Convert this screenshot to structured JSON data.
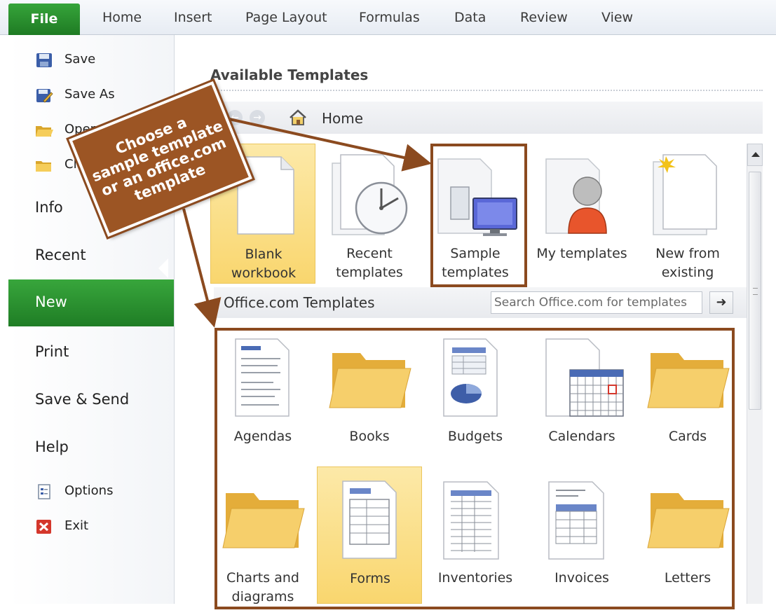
{
  "ribbon": {
    "tabs": [
      "File",
      "Home",
      "Insert",
      "Page Layout",
      "Formulas",
      "Data",
      "Review",
      "View"
    ]
  },
  "leftnav": {
    "commands": [
      {
        "label": "Save",
        "icon": "save-icon"
      },
      {
        "label": "Save As",
        "icon": "save-as-icon"
      },
      {
        "label": "Open",
        "icon": "open-folder-icon"
      },
      {
        "label": "Clo",
        "icon": "close-folder-icon"
      }
    ],
    "items": [
      "Info",
      "Recent",
      "New",
      "Print",
      "Save & Send",
      "Help"
    ],
    "bottom_commands": [
      {
        "label": "Options",
        "icon": "options-icon"
      },
      {
        "label": "Exit",
        "icon": "exit-icon"
      }
    ],
    "selected": "New"
  },
  "main": {
    "title": "Available Templates",
    "breadcrumb": {
      "back": "←",
      "forward": "→",
      "location": "Home"
    },
    "top_tiles": [
      {
        "line1": "Blank",
        "line2": "workbook",
        "icon": "blank-document-icon",
        "selected": true
      },
      {
        "line1": "Recent",
        "line2": "templates",
        "icon": "clock-document-icon",
        "selected": false
      },
      {
        "line1": "Sample",
        "line2": "templates",
        "icon": "monitor-document-icon",
        "selected": false
      },
      {
        "line1": "My templates",
        "line2": "",
        "icon": "user-document-icon",
        "selected": false
      },
      {
        "line1": "New from",
        "line2": "existing",
        "icon": "sparkle-document-icon",
        "selected": false
      }
    ],
    "office": {
      "title": "Office.com Templates",
      "search_placeholder": "Search Office.com for templates",
      "go_label": "➜"
    },
    "office_tiles": [
      {
        "line1": "Agendas",
        "line2": "",
        "icon": "agenda-document-icon",
        "selected": false
      },
      {
        "line1": "Books",
        "line2": "",
        "icon": "folder-icon",
        "selected": false
      },
      {
        "line1": "Budgets",
        "line2": "",
        "icon": "budget-document-icon",
        "selected": false
      },
      {
        "line1": "Calendars",
        "line2": "",
        "icon": "calendar-document-icon",
        "selected": false
      },
      {
        "line1": "Cards",
        "line2": "",
        "icon": "folder-icon",
        "selected": false
      },
      {
        "line1": "Charts and",
        "line2": "diagrams",
        "icon": "folder-icon",
        "selected": false
      },
      {
        "line1": "Forms",
        "line2": "",
        "icon": "form-document-icon",
        "selected": true
      },
      {
        "line1": "Inventories",
        "line2": "",
        "icon": "inventory-document-icon",
        "selected": false
      },
      {
        "line1": "Invoices",
        "line2": "",
        "icon": "invoice-document-icon",
        "selected": false
      },
      {
        "line1": "Letters",
        "line2": "",
        "icon": "folder-icon",
        "selected": false
      }
    ]
  },
  "annotation": {
    "callout_lines": [
      "Choose a",
      "sample template",
      "or an office.com",
      "template"
    ],
    "color": "#8b4a1f"
  },
  "colors": {
    "file_green": "#2a8f2e",
    "selected_tile": "#f9d66e"
  }
}
